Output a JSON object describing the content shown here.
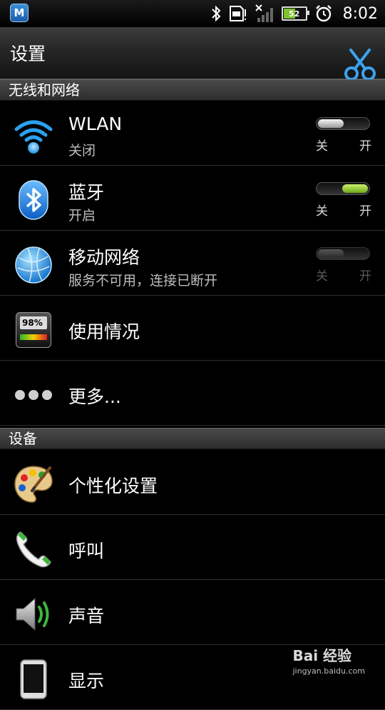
{
  "status_bar": {
    "app_badge": "M",
    "battery_level": "52",
    "time": "8:02",
    "icons": [
      "bluetooth-icon",
      "sd-card-icon",
      "no-signal-icon",
      "battery-icon",
      "alarm-icon"
    ]
  },
  "title_bar": {
    "title": "设置",
    "action_icon": "scissors-icon",
    "accent": "#3aa3f0"
  },
  "sections": [
    {
      "header": "无线和网络"
    },
    {
      "header": "设备"
    }
  ],
  "toggle_labels": {
    "off": "关",
    "on": "开"
  },
  "wireless_rows": [
    {
      "title": "WLAN",
      "subtitle": "关闭",
      "icon": "wifi-icon",
      "toggle": "off"
    },
    {
      "title": "蓝牙",
      "subtitle": "开启",
      "icon": "bluetooth-icon",
      "toggle": "on"
    },
    {
      "title": "移动网络",
      "subtitle": "服务不可用，连接已断开",
      "icon": "globe-icon",
      "toggle": "disabled"
    },
    {
      "title": "使用情况",
      "icon": "data-usage-meter-icon",
      "meter_text": "98%"
    },
    {
      "title": "更多...",
      "icon": "more-dots-icon"
    }
  ],
  "device_rows": [
    {
      "title": "个性化设置",
      "icon": "palette-icon"
    },
    {
      "title": "呼叫",
      "icon": "phone-icon"
    },
    {
      "title": "声音",
      "icon": "speaker-icon"
    },
    {
      "title": "显示",
      "icon": "display-phone-icon"
    }
  ],
  "watermark": {
    "main": "Bai 经验",
    "sub": "jingyan.baidu.com"
  }
}
